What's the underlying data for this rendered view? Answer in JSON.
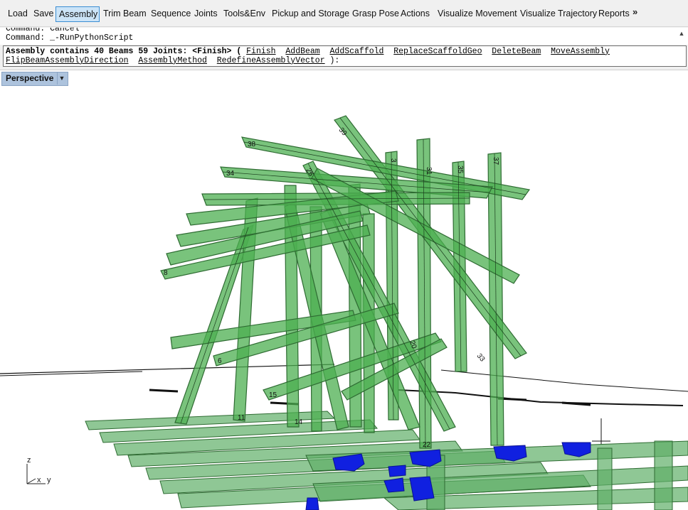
{
  "toolbar": {
    "tabs": [
      {
        "label": "Load",
        "active": false
      },
      {
        "label": "Save",
        "active": false
      },
      {
        "label": "Assembly",
        "active": true
      },
      {
        "label": "Trim Beam",
        "active": false
      },
      {
        "label": "Sequence",
        "active": false
      },
      {
        "label": "Joints",
        "active": false
      },
      {
        "label": "Tools&Env",
        "active": false
      },
      {
        "label": "Pickup and Storage",
        "active": false
      },
      {
        "label": "Grasp Pose",
        "active": false
      },
      {
        "label": "Actions",
        "active": false
      },
      {
        "label": "Visualize Movement",
        "active": false
      },
      {
        "label": "Visualize Trajectory",
        "active": false
      },
      {
        "label": "Reports",
        "active": false
      }
    ],
    "overflow": "»"
  },
  "command_history": {
    "line1": "Command: Cancel",
    "line2": "Command: _-RunPythonScript"
  },
  "command_prompt": {
    "message": "Assembly contains 40 Beams 59 Joints: <Finish> ( ",
    "options_row1": [
      "Finish",
      "AddBeam",
      "AddScaffold",
      "ReplaceScaffoldGeo",
      "DeleteBeam",
      "MoveAssembly"
    ],
    "options_row2": [
      "FlipBeamAssemblyDirection",
      "AssemblyMethod",
      "RedefineAssemblyVector"
    ],
    "end": " ):"
  },
  "viewport": {
    "name": "Perspective",
    "axes": {
      "z": "z",
      "x": "x",
      "y": "y"
    },
    "beam_labels": [
      "38",
      "39",
      "34",
      "25",
      "3",
      "31",
      "35",
      "37",
      "33",
      "20",
      "15",
      "14",
      "11",
      "22",
      "8",
      "6"
    ]
  },
  "colors": {
    "beam_fill": "#4caf50",
    "beam_edge": "#2e6b32",
    "gripper": "#1020e0",
    "active_tab": "#cce4f7",
    "viewport_tab": "#adc3dd"
  }
}
